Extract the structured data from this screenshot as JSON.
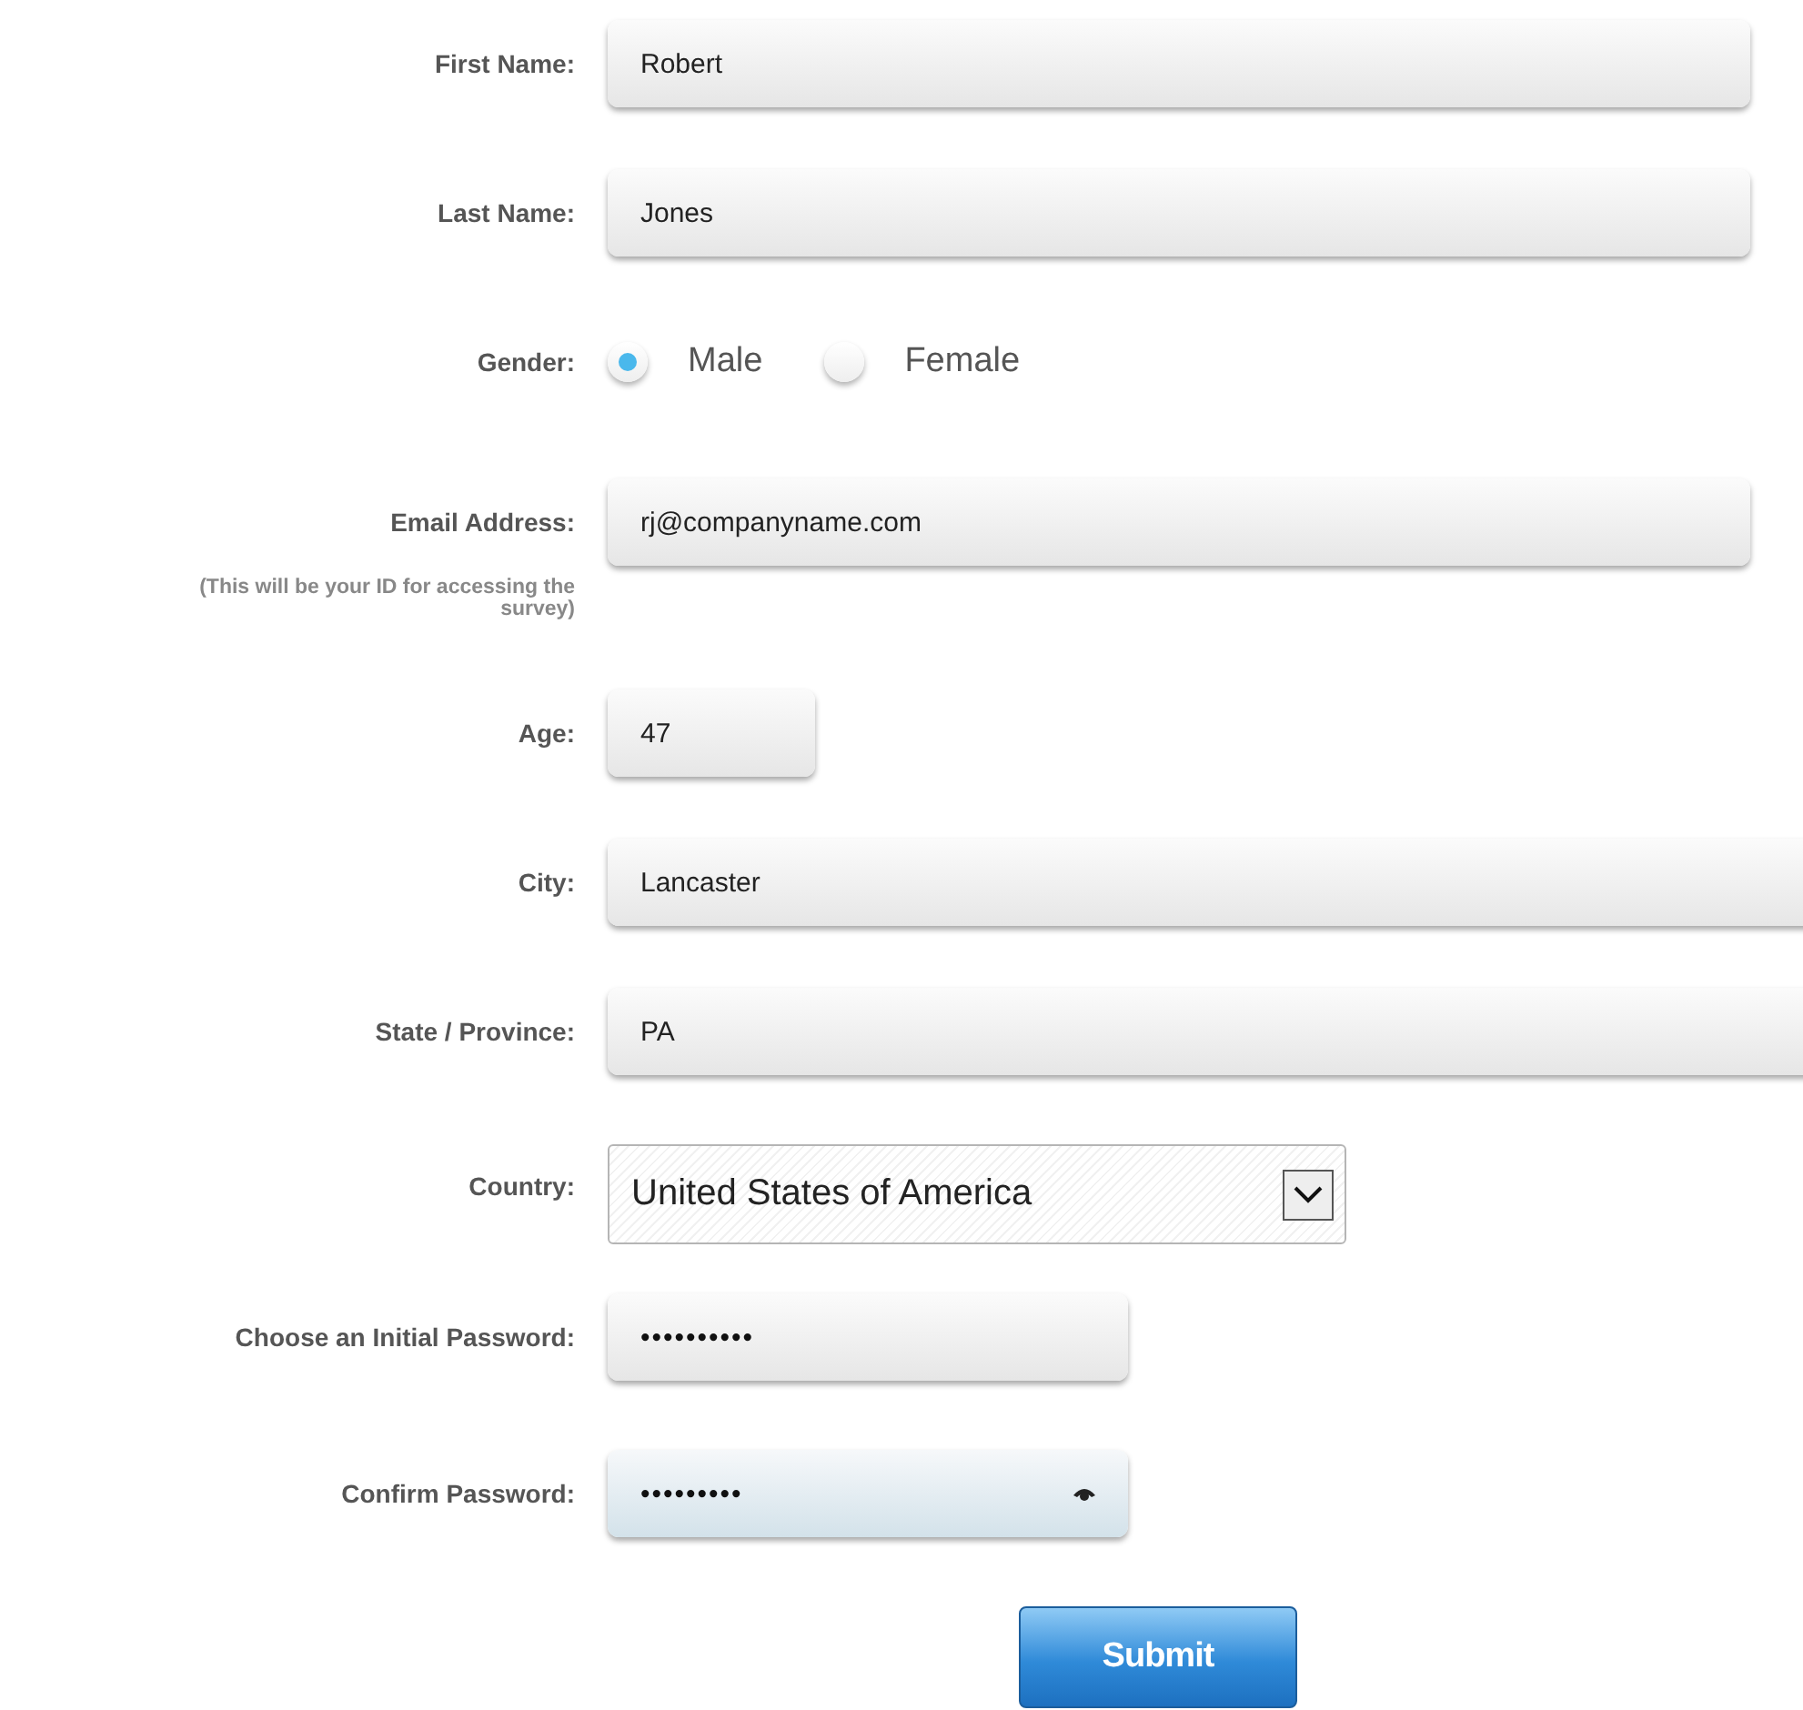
{
  "fields": [
    {
      "kind": "text",
      "label": "First Name:",
      "value": "Robert"
    },
    {
      "kind": "text",
      "label": "Last Name:",
      "value": "Jones"
    },
    {
      "kind": "radio",
      "label": "Gender:",
      "options": [
        {
          "label": "Male",
          "selected": true
        },
        {
          "label": "Female",
          "selected": false
        }
      ]
    },
    {
      "kind": "email",
      "label": "Email Address:",
      "note": "(This will be your ID for accessing the survey)",
      "value": "rj@companyname.com"
    },
    {
      "kind": "number",
      "label": "Age:",
      "value": "47"
    },
    {
      "kind": "location",
      "label": "City:",
      "value": "Lancaster"
    },
    {
      "kind": "location",
      "label": "State / Province:",
      "value": "PA"
    },
    {
      "kind": "select",
      "label": "Country:",
      "value": "United States of America"
    },
    {
      "kind": "password",
      "label": "Choose an Initial Password:",
      "value": "••••••••••",
      "focused": false
    },
    {
      "kind": "password",
      "label": "Confirm Password:",
      "value": "•••••••••",
      "focused": true
    }
  ],
  "submit": {
    "label": "Submit"
  }
}
